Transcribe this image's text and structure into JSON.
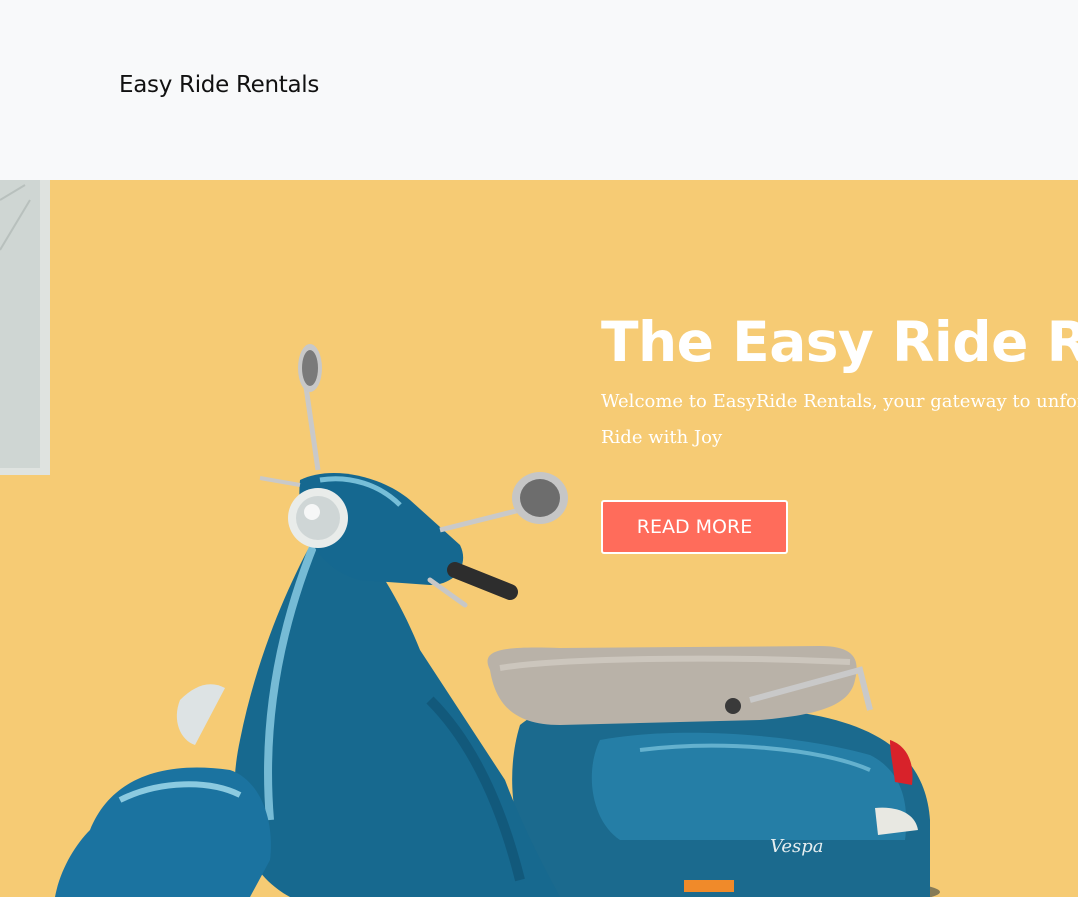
{
  "header": {
    "brand": "Easy Ride Rentals"
  },
  "hero": {
    "title": "The Easy Ride Re",
    "text_line1": "Welcome to EasyRide Rentals, your gateway to unforgettab",
    "text_line2": "Ride with Joy",
    "button_label": "READ MORE",
    "photo_subject": "blue scooter against yellow wall",
    "scooter_badge": "Vespa"
  },
  "colors": {
    "header_bg": "#f8f9fa",
    "wall_yellow": "#f5c96e",
    "scooter_blue": "#1d6f94",
    "button_bg": "#ff6c5b",
    "text_white": "#ffffff"
  }
}
